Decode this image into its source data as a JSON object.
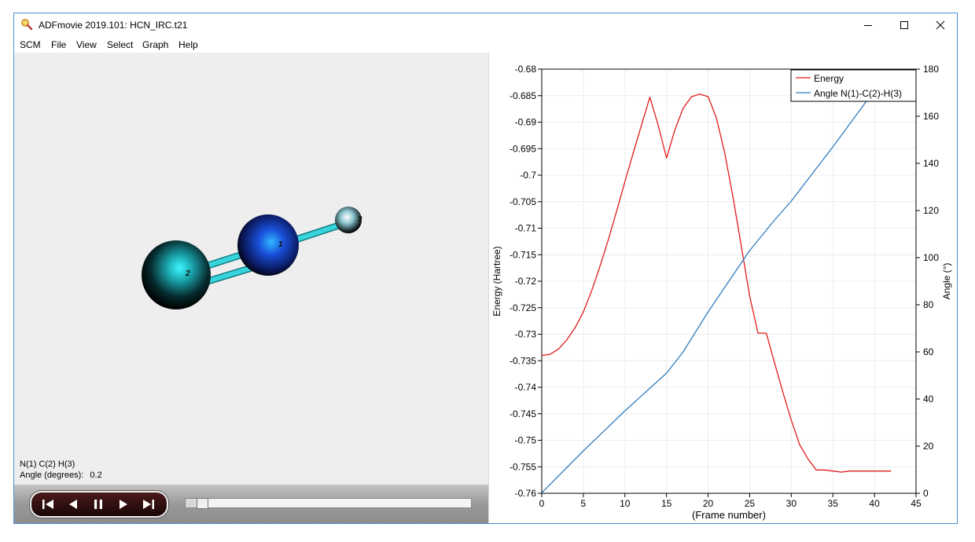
{
  "window": {
    "title": "ADFmovie 2019.101: HCN_IRC.t21",
    "icon": "magnifier-app-icon"
  },
  "menu": [
    "SCM",
    "File",
    "View",
    "Select",
    "Graph",
    "Help"
  ],
  "molecule": {
    "atoms": [
      {
        "label": "1",
        "element": "N",
        "color": "#1a4fd8"
      },
      {
        "label": "2",
        "element": "C",
        "color": "#00d0d8"
      },
      {
        "label": "3",
        "element": "H",
        "color": "#d0e0e8"
      }
    ],
    "bond_color": "#38d4dc"
  },
  "info": {
    "atoms_line": "N(1) C(2) H(3)",
    "angle_label": "Angle (degrees):",
    "angle_value": "0.2"
  },
  "playback": {
    "buttons": [
      "first-frame",
      "previous-frame",
      "pause",
      "next-frame",
      "last-frame"
    ],
    "position_fraction": 0.05
  },
  "chart_data": {
    "type": "line",
    "xlabel": "(Frame number)",
    "ylabel": "Energy (Hartree)",
    "y2label": "Angle (°)",
    "xlim": [
      0,
      45
    ],
    "ylim": [
      -0.76,
      -0.68
    ],
    "y2lim": [
      0,
      180
    ],
    "xticks": [
      0,
      5,
      10,
      15,
      20,
      25,
      30,
      35,
      40,
      45
    ],
    "yticks": [
      "-0.68",
      "-0.685",
      "-0.69",
      "-0.695",
      "-0.7",
      "-0.705",
      "-0.71",
      "-0.715",
      "-0.72",
      "-0.725",
      "-0.73",
      "-0.735",
      "-0.74",
      "-0.745",
      "-0.75",
      "-0.755",
      "-0.76"
    ],
    "y2ticks": [
      0,
      20,
      40,
      60,
      80,
      100,
      120,
      140,
      160,
      180
    ],
    "grid": true,
    "legend_position": "top-right",
    "series": [
      {
        "name": "Energy",
        "axis": "left",
        "color": "#e01c1c",
        "x": [
          0,
          1,
          2,
          3,
          4,
          5,
          6,
          7,
          8,
          9,
          10,
          11,
          12,
          13,
          14,
          15,
          16,
          17,
          18,
          19,
          20,
          21,
          22,
          23,
          24,
          25,
          26,
          27,
          28,
          29,
          30,
          31,
          32,
          33,
          34,
          35,
          36,
          37,
          38,
          39,
          40,
          41,
          42
        ],
        "y": [
          -0.734,
          -0.7338,
          -0.7328,
          -0.7311,
          -0.7288,
          -0.7258,
          -0.7218,
          -0.7172,
          -0.7122,
          -0.7068,
          -0.7012,
          -0.6958,
          -0.6905,
          -0.6853,
          -0.6906,
          -0.6968,
          -0.6915,
          -0.6874,
          -0.6852,
          -0.6847,
          -0.6852,
          -0.6892,
          -0.6958,
          -0.7042,
          -0.7135,
          -0.7228,
          -0.7298,
          -0.7298,
          -0.7355,
          -0.741,
          -0.7462,
          -0.7508,
          -0.7535,
          -0.7556,
          -0.7556,
          -0.7558,
          -0.756,
          -0.7558,
          -0.7558,
          -0.7558,
          -0.7558,
          -0.7558,
          -0.7558
        ]
      },
      {
        "name": "Angle N(1)-C(2)-H(3)",
        "axis": "right",
        "color": "#2f7dc0",
        "x": [
          0,
          5,
          10,
          15,
          17,
          20,
          25,
          28,
          30,
          35,
          40
        ],
        "y": [
          0.2,
          18,
          35,
          51,
          60,
          77,
          103,
          116,
          124,
          147,
          171
        ]
      }
    ]
  }
}
